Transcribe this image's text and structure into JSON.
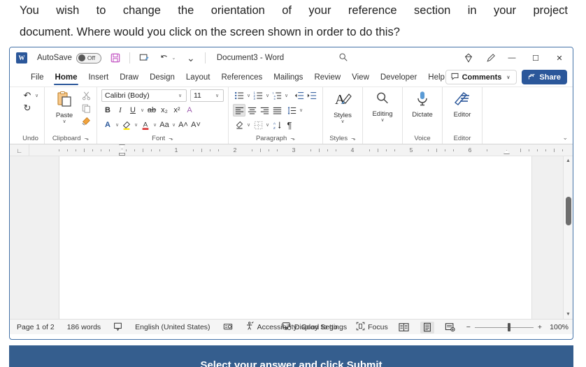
{
  "question": {
    "line1": "You wish to change the orientation of your reference section in your project",
    "line2": "document. Where would you click on the screen shown in order to do this?"
  },
  "titlebar": {
    "app_logo": "W",
    "autosave_label": "AutoSave",
    "autosave_state": "Off",
    "save_icon": "save-icon",
    "touch_icon": "touch-mode-icon",
    "undo_icon": "undo-icon",
    "customize_icon": "customize-quick-access-icon",
    "document_title": "Document3  -  Word",
    "search_icon": "search-icon",
    "diamond_icon": "microsoft-365-icon",
    "pen_icon": "ink-pen-icon",
    "minimize": "—",
    "maximize": "☐",
    "close": "✕"
  },
  "tabs": [
    {
      "label": "File",
      "active": false
    },
    {
      "label": "Home",
      "active": true
    },
    {
      "label": "Insert",
      "active": false
    },
    {
      "label": "Draw",
      "active": false
    },
    {
      "label": "Design",
      "active": false
    },
    {
      "label": "Layout",
      "active": false
    },
    {
      "label": "References",
      "active": false
    },
    {
      "label": "Mailings",
      "active": false
    },
    {
      "label": "Review",
      "active": false
    },
    {
      "label": "View",
      "active": false
    },
    {
      "label": "Developer",
      "active": false
    },
    {
      "label": "Help",
      "active": false
    }
  ],
  "tabbar_right": {
    "comments_label": "Comments",
    "comments_icon": "comment-bubble-icon",
    "comments_caret": "∨",
    "share_label": "Share",
    "share_icon": "share-icon"
  },
  "ribbon": {
    "collapse_caret": "⌄",
    "groups": [
      {
        "name": "undo",
        "label": "Undo",
        "buttons": [
          {
            "name": "undo-button",
            "glyph": "↶",
            "caret": "∨"
          },
          {
            "name": "redo-button",
            "glyph": "↻",
            "caret": ""
          }
        ]
      },
      {
        "name": "clipboard",
        "label": "Clipboard",
        "paste_label": "Paste",
        "paste_caret": "∨",
        "cut_icon": "scissors-icon",
        "copy_icon": "copy-icon",
        "format_painter_icon": "format-painter-icon",
        "dialog_launcher": "⬎"
      },
      {
        "name": "font",
        "label": "Font",
        "font_name": "Calibri (Body)",
        "font_size": "11",
        "caret": "∨",
        "bold": "B",
        "italic": "I",
        "underline": "U",
        "strikethrough": "ab",
        "subscript": "x₂",
        "superscript": "x²",
        "clear_formatting": "A",
        "text_effects": "A",
        "highlight": "✎",
        "font_color": "A",
        "change_case": "Aa",
        "grow_font": "A˄",
        "shrink_font": "A˅",
        "dialog_launcher": "⬎"
      },
      {
        "name": "paragraph",
        "label": "Paragraph",
        "bullets": "≡",
        "numbering": "≡",
        "multilevel": "≡",
        "decrease_indent": "⇤",
        "increase_indent": "⇥",
        "align_left": "≡",
        "align_center": "≡",
        "align_right": "≡",
        "justify": "≡",
        "line_spacing": "↕",
        "shading": "⬛",
        "borders": "⬚",
        "sort": "A↓",
        "show_marks": "¶",
        "dialog_launcher": "⬎"
      },
      {
        "name": "styles",
        "label": "Styles",
        "button_label": "Styles",
        "glyph": "A",
        "caret": "∨",
        "dialog_launcher": "⬎"
      },
      {
        "name": "editing",
        "label": "",
        "button_label": "Editing",
        "glyph": "⌕",
        "caret": "∨"
      },
      {
        "name": "voice",
        "label": "Voice",
        "button_label": "Dictate",
        "glyph": "ᴘ"
      },
      {
        "name": "editor",
        "label": "Editor",
        "button_label": "Editor",
        "glyph": "✎"
      }
    ]
  },
  "ruler": {
    "corner_icon": "tab-stop-icon",
    "numbers": [
      "1",
      "2",
      "3",
      "4",
      "5",
      "6"
    ],
    "left_indent_icon": "left-indent-marker",
    "right_indent_icon": "right-indent-marker"
  },
  "document": {
    "scroll_up_arrow": "▲",
    "scroll_down_arrow": "▼"
  },
  "statusbar": {
    "page": "Page 1 of 2",
    "words": "186 words",
    "proofing_icon": "proofing-errors-icon",
    "language": "English (United States)",
    "track_changes_icon": "track-changes-icon",
    "accessibility_icon": "accessibility-icon",
    "accessibility": "Accessibility: Good to go",
    "display_settings_icon": "display-settings-icon",
    "display_settings": "Display Settings",
    "focus_icon": "focus-mode-icon",
    "focus": "Focus",
    "view_read": "read-mode-icon",
    "view_print": "print-layout-icon",
    "view_web": "web-layout-icon",
    "zoom_out": "−",
    "zoom_in": "+",
    "zoom_level": "100%"
  },
  "banner": {
    "text": "Select your answer and click Submit"
  },
  "colors": {
    "accent": "#2b579a",
    "banner_bg": "#355e8e",
    "window_border": "#4472a8",
    "autosave_off": "#585858"
  }
}
